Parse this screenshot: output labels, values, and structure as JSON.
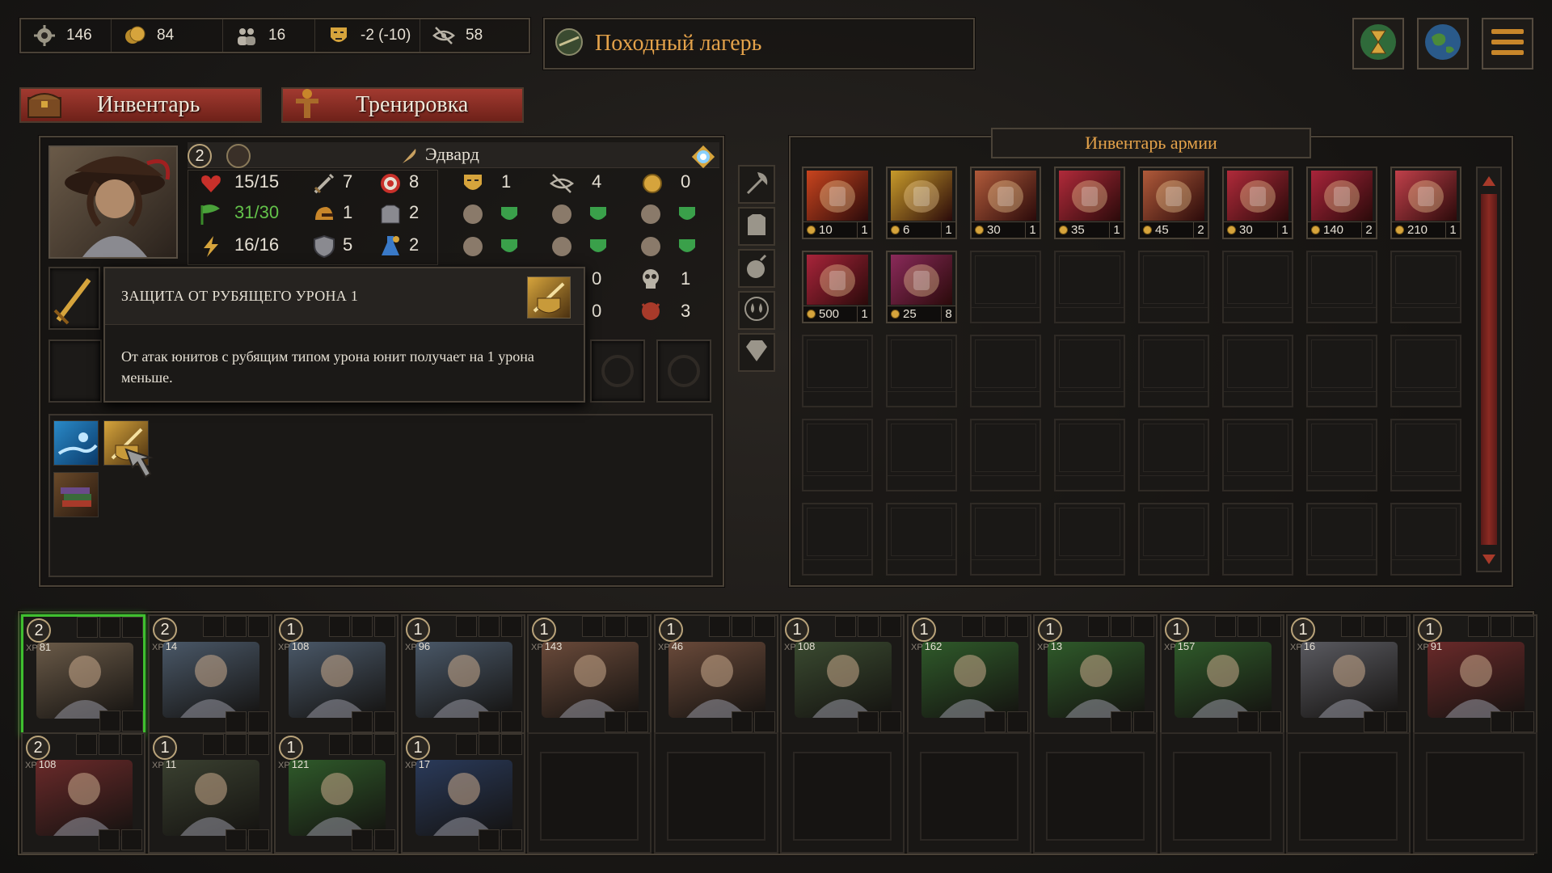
{
  "resources": [
    {
      "icon": "gear-resource-icon",
      "value": "146"
    },
    {
      "icon": "gold-coins-icon",
      "value": "84"
    },
    {
      "icon": "population-icon",
      "value": "16"
    },
    {
      "icon": "mood-mask-icon",
      "value": "-2 (-10)"
    },
    {
      "icon": "stealth-eye-icon",
      "value": "58"
    }
  ],
  "location": {
    "title": "Походный лагерь"
  },
  "tabs": {
    "inventory": "Инвентарь",
    "training": "Тренировка"
  },
  "hero": {
    "name": "Эдвард",
    "level": "2",
    "stats_left": [
      {
        "icon": "heart-icon",
        "value": "15/15",
        "color": "#e6e0d4"
      },
      {
        "icon": "morale-flag-icon",
        "value": "31/30",
        "color": "#63c24a"
      },
      {
        "icon": "energy-bolt-icon",
        "value": "16/16",
        "color": "#e6e0d4"
      }
    ],
    "stats_mid": [
      {
        "icon": "sword-icon",
        "value": "7"
      },
      {
        "icon": "helmet-icon",
        "value": "1"
      },
      {
        "icon": "shield-icon",
        "value": "5"
      }
    ],
    "stats_right": [
      {
        "icon": "target-icon",
        "value": "8"
      },
      {
        "icon": "armor-icon",
        "value": "2"
      },
      {
        "icon": "magic-flask-icon",
        "value": "2"
      }
    ],
    "stats_far": [
      {
        "icon": "mask-icon",
        "value": "1"
      },
      {
        "icon": "eye-slash-icon",
        "value": "4"
      },
      {
        "icon": "coin-stack-icon",
        "value": "0"
      }
    ],
    "resist_extra": [
      "0",
      "1",
      "0",
      "3"
    ]
  },
  "tooltip": {
    "title": "ЗАЩИТА ОТ РУБЯЩЕГО УРОНА 1",
    "body": "От атак юнитов с рубящим типом урона юнит получает на 1 урона меньше."
  },
  "army_inventory": {
    "title": "Инвентарь армии",
    "items": [
      {
        "icon": "fire-potion-icon",
        "price": "10",
        "count": "1",
        "color": "#c8441e"
      },
      {
        "icon": "gold-jar-icon",
        "price": "6",
        "count": "1",
        "color": "#c79a2a"
      },
      {
        "icon": "scroll-icon",
        "price": "30",
        "count": "1",
        "color": "#b05a3a"
      },
      {
        "icon": "skull-scroll-icon",
        "price": "35",
        "count": "1",
        "color": "#b02a3a"
      },
      {
        "icon": "banner-scroll-icon",
        "price": "45",
        "count": "2",
        "color": "#b05a3a"
      },
      {
        "icon": "beast-scroll-icon",
        "price": "30",
        "count": "1",
        "color": "#b02a3a"
      },
      {
        "icon": "ingot-icon",
        "price": "140",
        "count": "2",
        "color": "#a8243a"
      },
      {
        "icon": "leather-icon",
        "price": "210",
        "count": "1",
        "color": "#c0404a"
      },
      {
        "icon": "gems-icon",
        "price": "500",
        "count": "1",
        "color": "#a8243a"
      },
      {
        "icon": "feather-scroll-icon",
        "price": "25",
        "count": "8",
        "color": "#8a2a5a"
      }
    ]
  },
  "units_row1": [
    {
      "level": "2",
      "xp": "81",
      "selected": true,
      "color": "#6a5a48"
    },
    {
      "level": "2",
      "xp": "14",
      "color": "#4a5868"
    },
    {
      "level": "1",
      "xp": "108",
      "color": "#4a5868"
    },
    {
      "level": "1",
      "xp": "96",
      "color": "#4a5868"
    },
    {
      "level": "1",
      "xp": "143",
      "color": "#6a4a3a"
    },
    {
      "level": "1",
      "xp": "46",
      "color": "#6a4a3a"
    },
    {
      "level": "1",
      "xp": "108",
      "color": "#3a4a30"
    },
    {
      "level": "1",
      "xp": "162",
      "color": "#2f5a2a"
    },
    {
      "level": "1",
      "xp": "13",
      "color": "#2f5a2a"
    },
    {
      "level": "1",
      "xp": "157",
      "color": "#2f5a2a"
    },
    {
      "level": "1",
      "xp": "16",
      "color": "#5a5a60"
    },
    {
      "level": "1",
      "xp": "91",
      "color": "#6a2a2a"
    }
  ],
  "units_row2": [
    {
      "level": "2",
      "xp": "108",
      "color": "#6a2a2a"
    },
    {
      "level": "1",
      "xp": "11",
      "color": "#3a4030"
    },
    {
      "level": "1",
      "xp": "121",
      "color": "#2f5a2a"
    },
    {
      "level": "1",
      "xp": "17",
      "color": "#2a3a5a"
    }
  ],
  "xp_label": "XP"
}
